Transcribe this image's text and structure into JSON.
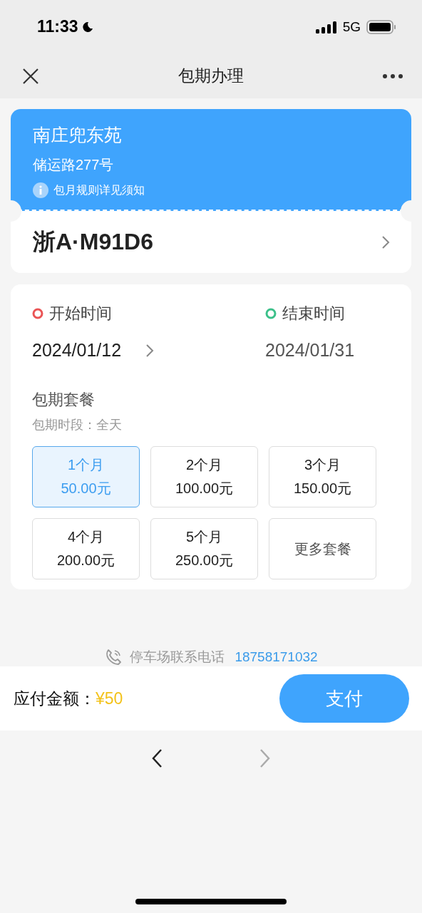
{
  "status_bar": {
    "time": "11:33",
    "network": "5G"
  },
  "nav_bar": {
    "title": "包期办理"
  },
  "parking_lot": {
    "name": "南庄兜东苑",
    "address": "储运路277号",
    "notice": "包月规则详见须知"
  },
  "vehicle": {
    "plate": "浙A·M91D6"
  },
  "period": {
    "start_label": "开始时间",
    "start_date": "2024/01/12",
    "end_label": "结束时间",
    "end_date": "2024/01/31"
  },
  "packages": {
    "title": "包期套餐",
    "subtitle": "包期时段：全天",
    "options": [
      {
        "kind": "plan",
        "duration": "1个月",
        "price": "50.00元",
        "selected": true
      },
      {
        "kind": "plan",
        "duration": "2个月",
        "price": "100.00元",
        "selected": false
      },
      {
        "kind": "plan",
        "duration": "3个月",
        "price": "150.00元",
        "selected": false
      },
      {
        "kind": "plan",
        "duration": "4个月",
        "price": "200.00元",
        "selected": false
      },
      {
        "kind": "plan",
        "duration": "5个月",
        "price": "250.00元",
        "selected": false
      },
      {
        "kind": "more",
        "label": "更多套餐",
        "selected": false
      }
    ]
  },
  "contact": {
    "label": "停车场联系电话",
    "phone": "18758171032"
  },
  "payment": {
    "label": "应付金额：",
    "amount": "¥50",
    "button": "支付"
  },
  "browser_nav": {
    "back_disabled": false,
    "forward_disabled": true
  }
}
